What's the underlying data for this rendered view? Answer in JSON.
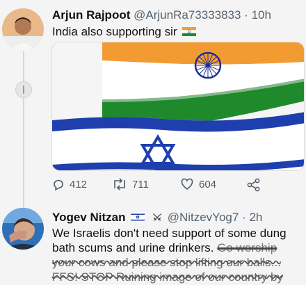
{
  "tweets": [
    {
      "author": {
        "name": "Arjun Rajpoot",
        "handle": "@ArjunRa73333833",
        "time": "10h"
      },
      "text": "India also supporting sir",
      "stats": {
        "replies": "412",
        "retweets": "711",
        "likes": "604"
      }
    },
    {
      "author": {
        "name": "Yogev Nitzan",
        "handle": "@NitzevYog7",
        "time": "2h"
      },
      "text_line1": "We Israelis don't need support of some dung",
      "text_line2": "bath scums and urine drinkers.",
      "text_line2_scribbled": "Go worship",
      "text_line3": "your cows and please stop lifting our balls...",
      "text_line4": "FFS! STOP Ruining image of our country by"
    }
  ],
  "separator": "·",
  "icons": [
    "reply-icon",
    "retweet-icon",
    "like-icon",
    "share-icon",
    "india-flag-icon",
    "israel-flag-icon",
    "crossed-swords-icon"
  ],
  "colors": {
    "saffron": "#f39b33",
    "india_green": "#1f8a2c",
    "chakra_blue": "#1c2f8f",
    "israel_blue": "#1f3fae"
  }
}
